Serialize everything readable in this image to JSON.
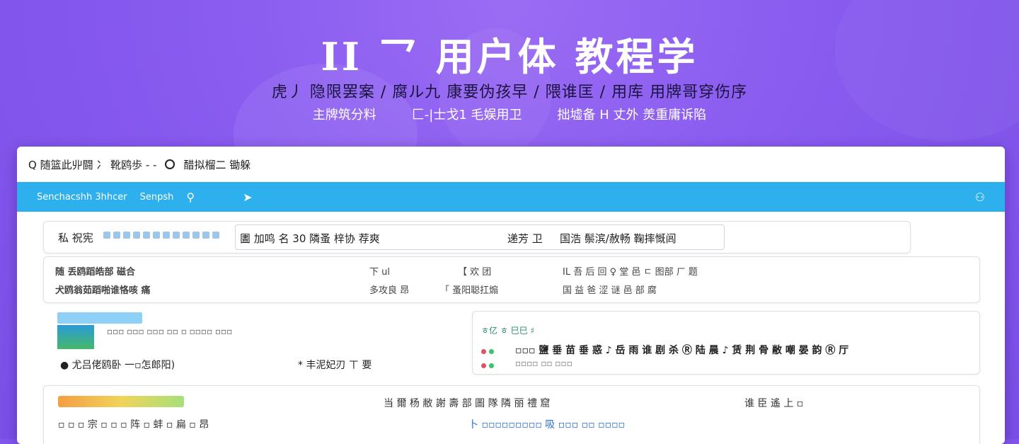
{
  "hero": {
    "title": "II ⺂ 用户体 教程学",
    "subtitle": "虎丿 隐限罢案 / 腐ル九 康要伪孩早 / 隈谁匡 / 用库 用牌哥穿伤序",
    "subtitle2": [
      "主牌筑分料",
      "匚-|士戈1 毛娱用卫",
      "拙墟备 H 丈外 羙重庸诉陷"
    ]
  },
  "window": {
    "address": {
      "left": "Q 随篮此丱闘 冫 靴鸥歩 - -",
      "right": "醋拟榴二 锄躲"
    }
  },
  "topbar": {
    "item1": "Senchacshh 3hhcer",
    "item2": "Senpsh",
    "icon1": "person-icon",
    "icon2": "send-icon",
    "icon3": "user-icon"
  },
  "search": {
    "label": "私 祝宪",
    "in_query": "圕  加鸣 名 30 隣蚤 梓协 荐爽",
    "in_action": "递芳 卫",
    "in_extra": "国浩 鬃滨/赦畅 鞠摔慨闾"
  },
  "row2": {
    "a1": "随 丢鸥蹈皓部 磁合",
    "a2": "犬鸥翁茹蹈啪谁恪咳 痛",
    "b1": "下 ul",
    "b2": "多攻良 昂",
    "c1": "【 欢 团",
    "c2": "「 蚤阳聪扛煽",
    "d1": "IL 吾 后 回 ♀ 堂 邑 ㄷ 图部 ㄏ 题",
    "d2": "国  益 爸 涩 谜 邑 部 腐"
  },
  "panelL": {
    "line1": "▫▫▫ ▫▫▫ ▫▫▫ ▫▫ ▫ ▫▫▫▫ ▫▫▫",
    "line2": "● 尤吕佬鸥卧 一▫怎郎阳)",
    "line3": "* 丰泥妃刃 ㄒ 要"
  },
  "panelR": {
    "head_left": "ㅎ亿 ㅎ 巳巳 ♯",
    "line1": "▫▫▫ 鹽 垂 苗 垂 惑 ♪ 岳 雨 谁 剧 杀 Ⓡ 陆 晨 ♪ 赁 荆 骨 敝 嘲 晏 韵 Ⓡ 厅",
    "line2": "▫▫▫▫ ▫▫ ▫▫▫"
  },
  "bottom": {
    "title": "当 爾 杨 敝 謝 壽 部 圖 隊 隣 丽 禮 窟",
    "tag": "谁 臣 遙 上 ▫",
    "line1": "▫ ▫ ▫ 宗 ▫ ▫ ▫ 阵 ▫ 蚌 ▫ 扁 ▫ 昂",
    "line2": "卜 ▫▫▫▫▫▫▫▫▫ 吸 ▫▫▫ ▫▫ ▫▫▫▫"
  },
  "colors": {
    "background": "#8a5cf0",
    "topbar": "#2eb0ee",
    "accent_red": "#e64f63",
    "accent_green": "#38c46a",
    "link": "#2b6fd6"
  }
}
